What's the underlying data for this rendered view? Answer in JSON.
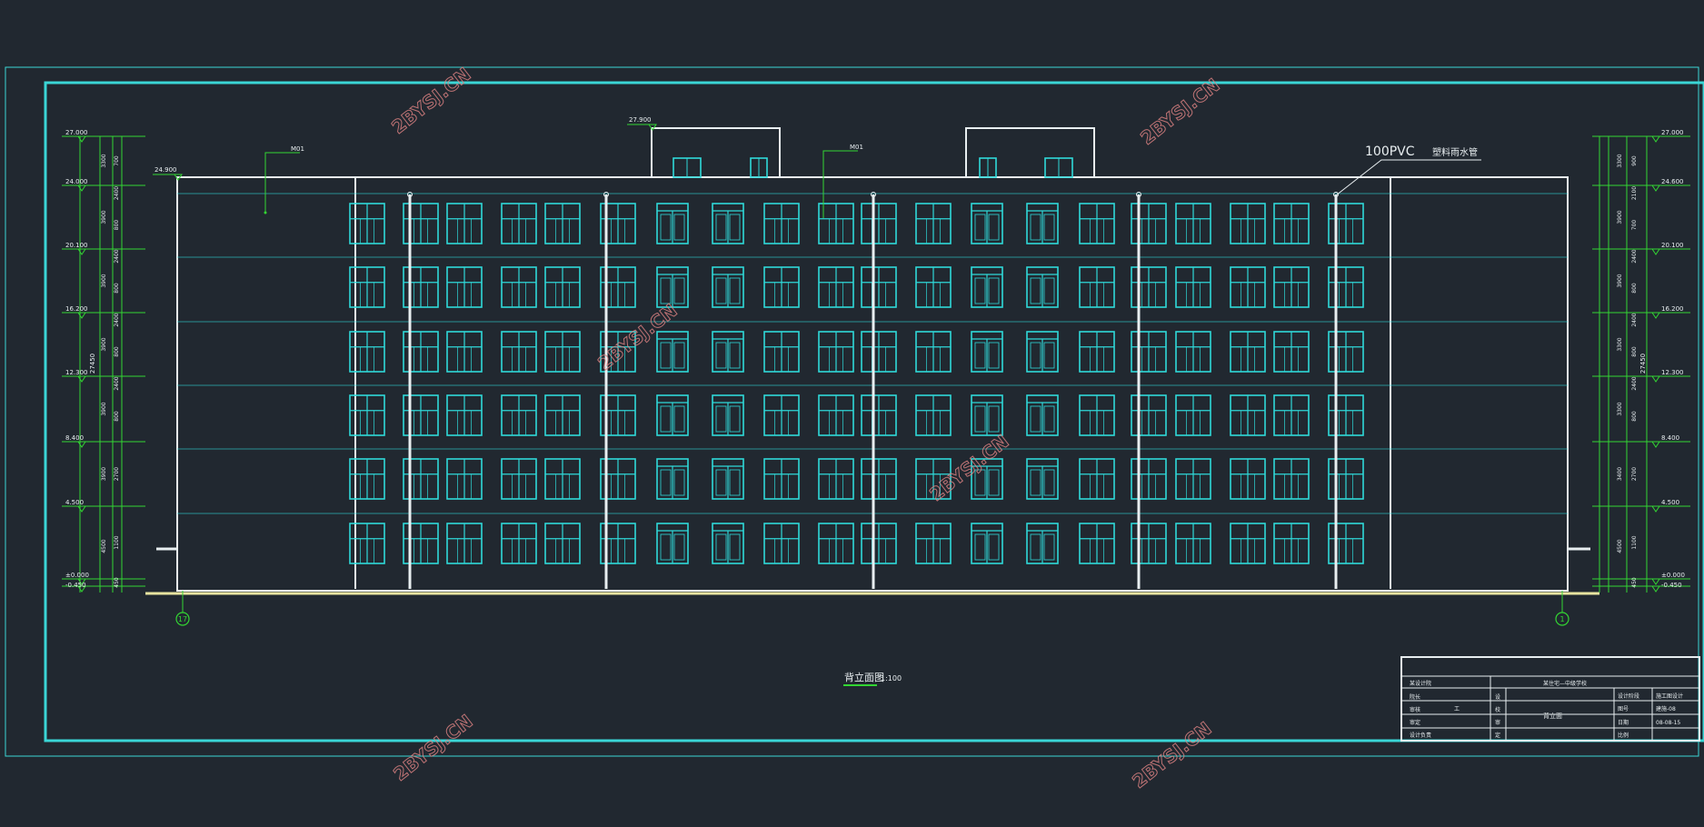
{
  "colors": {
    "background": "#212830",
    "frame": "#3ad6d6",
    "building": "#e8eef0",
    "window": "#2fd9d9",
    "dimension": "#33d633",
    "watermark": "#d98080"
  },
  "drawing": {
    "title": "背立面图",
    "scale": "1:100",
    "leader_note_size": "100PVC",
    "leader_note_text": "塑料雨水管",
    "tag_left": "M01",
    "tag_mid": "M01",
    "roof_level": "27.900",
    "parapet_level": "24.900"
  },
  "elevations_left": [
    "27.000",
    "24.000",
    "20.100",
    "16.200",
    "12.300",
    "8.400",
    "4.500",
    "±0.000",
    "-0.450"
  ],
  "elevations_right": [
    "27.000",
    "24.600",
    "20.100",
    "16.200",
    "12.300",
    "8.400",
    "4.500",
    "±0.000",
    "-0.450"
  ],
  "dims_left_col1": [
    "3300",
    "3900",
    "3900",
    "3900",
    "3900",
    "3900",
    "4500"
  ],
  "dims_left_col2": [
    "700",
    "2400",
    "800",
    "2400",
    "800",
    "2400",
    "800",
    "2400",
    "800",
    "2700",
    "1100",
    "450"
  ],
  "dims_left_total": "27450",
  "dims_right_col1": [
    "3300",
    "3900",
    "3900",
    "3300",
    "3300",
    "3400",
    "4500"
  ],
  "dims_right_col2": [
    "900",
    "2100",
    "700",
    "2400",
    "800",
    "2400",
    "800",
    "2400",
    "800",
    "2700",
    "1100",
    "450"
  ],
  "dims_right_total": "27450",
  "axis_left": "17",
  "axis_right": "1",
  "title_block": {
    "project": "某住宅—中级学校",
    "design_unit": "某设计院",
    "drawing_name": "背立面",
    "stage_label": "设计阶段",
    "stage_value": "施工图设计",
    "no_label": "图号",
    "no_value": "建施-08",
    "date_label": "日期",
    "date_value": "08-08-15",
    "scale_label": "比例",
    "row_labels": [
      "院长",
      "审核",
      "审定",
      "设计负责"
    ],
    "mid_labels": [
      "设",
      "校",
      "审",
      "定"
    ],
    "work_mark": "工"
  },
  "watermark_text": "2BYSJ.CN"
}
